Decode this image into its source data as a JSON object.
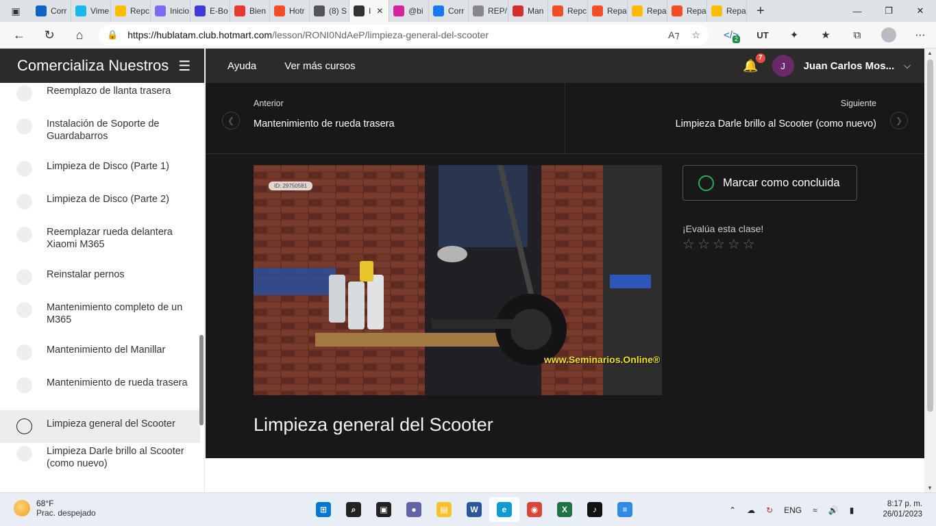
{
  "browser": {
    "tabs": [
      {
        "label": "Corr",
        "favicon_color": "#0a66c2",
        "icon": "outlook-icon"
      },
      {
        "label": "Vime",
        "favicon_color": "#1ab7ea",
        "icon": "vimeo-icon"
      },
      {
        "label": "Repc",
        "favicon_color": "#fbbc04",
        "icon": "drive-icon"
      },
      {
        "label": "Inicio",
        "favicon_color": "#7c6cf2",
        "icon": "canva-icon"
      },
      {
        "label": "E-Bo",
        "favicon_color": "#3d3dd6",
        "icon": "ebook-icon"
      },
      {
        "label": "Bien",
        "favicon_color": "#e53935",
        "icon": "youtube-icon"
      },
      {
        "label": "Hotr",
        "favicon_color": "#f04e23",
        "icon": "hotmart-icon"
      },
      {
        "label": "(8) S",
        "favicon_color": "#555555",
        "icon": "medium-icon"
      },
      {
        "label": "I",
        "favicon_color": "#333333",
        "icon": "speaker-icon",
        "active": true
      },
      {
        "label": "@bi",
        "favicon_color": "#d6249f",
        "icon": "instagram-icon"
      },
      {
        "label": "Corr",
        "favicon_color": "#1877f2",
        "icon": "facebook-icon"
      },
      {
        "label": "REP/",
        "favicon_color": "#888888",
        "icon": "document-icon"
      },
      {
        "label": "Man",
        "favicon_color": "#d32f2f",
        "icon": "slides-icon"
      },
      {
        "label": "Repc",
        "favicon_color": "#f04e23",
        "icon": "record-icon"
      },
      {
        "label": "Repa",
        "favicon_color": "#f04e23",
        "icon": "hotmart-icon"
      },
      {
        "label": "Repa",
        "favicon_color": "#fbbc04",
        "icon": "drive-icon"
      },
      {
        "label": "Repa",
        "favicon_color": "#f04e23",
        "icon": "hotmart-icon"
      },
      {
        "label": "Repa",
        "favicon_color": "#fbbc04",
        "icon": "drive-icon"
      }
    ],
    "url_host": "https://hublatam.club.hotmart.com",
    "url_path": "/lesson/RONI0NdAeP/limpieza-general-del-scooter",
    "ext_badge": "2",
    "ext_ut": "UT"
  },
  "sidebar": {
    "course_title": "Comercializa Nuestros",
    "lessons": [
      {
        "label": "Reemplazo de llanta trasera"
      },
      {
        "label": "Instalación de Soporte de Guardabarros"
      },
      {
        "label": "Limpieza de Disco (Parte 1)"
      },
      {
        "label": "Limpieza de Disco (Parte 2)"
      },
      {
        "label": "Reemplazar rueda delantera Xiaomi M365"
      },
      {
        "label": "Reinstalar pernos"
      },
      {
        "label": "Mantenimiento completo de un M365"
      },
      {
        "label": "Mantenimiento del Manillar"
      },
      {
        "label": "Mantenimiento de rueda trasera"
      },
      {
        "label": "Limpieza general del Scooter",
        "current": true
      },
      {
        "label": "Limpieza Darle brillo al Scooter (como nuevo)"
      }
    ]
  },
  "topnav": {
    "help": "Ayuda",
    "more_courses": "Ver más cursos",
    "notif_count": "7",
    "user_initial": "J",
    "user_name": "Juan Carlos Mos..."
  },
  "lesson": {
    "prev_label": "Anterior",
    "prev_title": "Mantenimiento de rueda trasera",
    "next_label": "Siguiente",
    "next_title": "Limpieza Darle brillo al Scooter (como nuevo)",
    "video_id": "ID: 29750581",
    "video_watermark": "www.Seminarios.Online®",
    "title": "Limpieza general del Scooter",
    "mark_complete": "Marcar como concluida",
    "rate_label": "¡Evalúa esta clase!",
    "rating": 0,
    "rating_max": 5
  },
  "taskbar": {
    "temp": "68°F",
    "weather_desc": "Prac. despejado",
    "lang": "ENG",
    "time": "8:17 p. m.",
    "date": "26/01/2023",
    "apps": [
      {
        "icon": "windows-start-icon",
        "color": "#0078d4"
      },
      {
        "icon": "search-icon",
        "color": "#222222"
      },
      {
        "icon": "task-view-icon",
        "color": "#222222"
      },
      {
        "icon": "teams-chat-icon",
        "color": "#6264a7"
      },
      {
        "icon": "file-explorer-icon",
        "color": "#f8c12c"
      },
      {
        "icon": "word-icon",
        "color": "#2b579a"
      },
      {
        "icon": "edge-icon",
        "color": "#0c9bd6",
        "active": true
      },
      {
        "icon": "chrome-icon",
        "color": "#db4437"
      },
      {
        "icon": "excel-icon",
        "color": "#217346"
      },
      {
        "icon": "tiktok-icon",
        "color": "#111111"
      },
      {
        "icon": "notepad-icon",
        "color": "#2f8be6"
      }
    ]
  }
}
